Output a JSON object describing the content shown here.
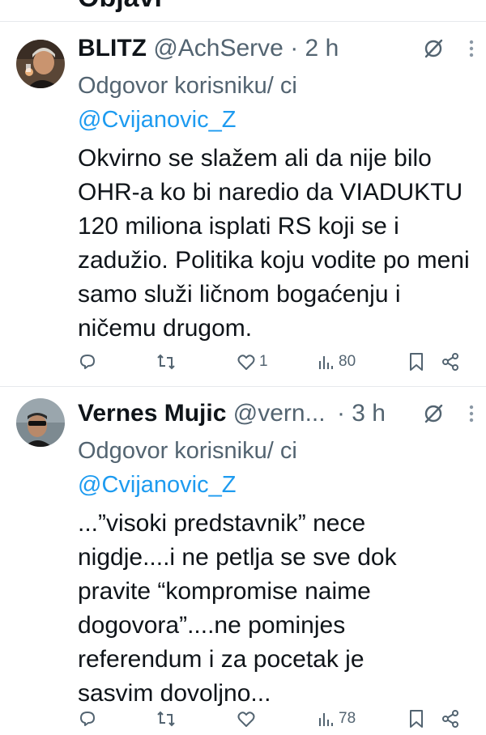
{
  "header_partial_title": "Objavi",
  "tweets": [
    {
      "name": "BLITZ",
      "handle": "@AchServe",
      "dot": "·",
      "time": "2 h",
      "reply_prefix": "Odgovor korisniku/ ci ",
      "reply_mention": "@Cvijanovic_Z",
      "text": "Okvirno se slažem ali da nije bilo OHR-a ko bi naredio da VIADUKTU 120 miliona isplati RS koji se i zadužio. Politika koju vodite po meni samo služi ličnom bogaćenju i ničemu drugom.",
      "likes": "1",
      "views": "80"
    },
    {
      "name": "Vernes Mujic",
      "handle": "@vern...",
      "dot": "·",
      "time": "3 h",
      "reply_prefix": "Odgovor korisniku/ ci ",
      "reply_mention": "@Cvijanovic_Z",
      "text": "...”visoki predstavnik” nece nigdje....i ne petlja se sve dok pravite “kompromise naime dogovora”....ne pominjes referendum i za pocetak je sasvim dovoljno...",
      "likes": "",
      "views": "78"
    }
  ],
  "icons": {
    "reply": "reply-icon",
    "retweet": "retweet-icon",
    "like": "heart-icon",
    "views": "views-icon",
    "bookmark": "bookmark-icon",
    "share": "share-icon",
    "grok": "grok-icon",
    "more": "more-icon"
  },
  "colors": {
    "text": "#0f1419",
    "secondary": "#536471",
    "link": "#1d9bf0",
    "divider": "#e6e9ec"
  }
}
